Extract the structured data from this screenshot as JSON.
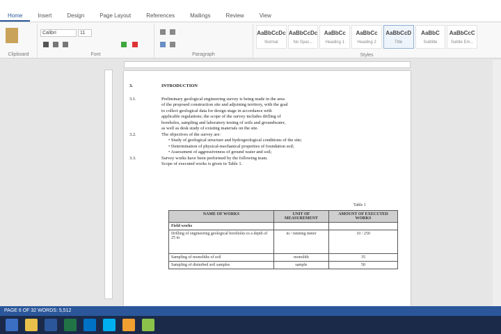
{
  "window": {
    "title": ""
  },
  "tabs": [
    {
      "label": "Home",
      "active": true
    },
    {
      "label": "Insert",
      "active": false
    },
    {
      "label": "Design",
      "active": false
    },
    {
      "label": "Page Layout",
      "active": false
    },
    {
      "label": "References",
      "active": false
    },
    {
      "label": "Mailings",
      "active": false
    },
    {
      "label": "Review",
      "active": false
    },
    {
      "label": "View",
      "active": false
    }
  ],
  "ribbon": {
    "font": "Calibri",
    "size": "11",
    "groups": [
      "Clipboard",
      "Font",
      "Paragraph",
      "Styles"
    ],
    "styles": [
      "AaBbCcDc",
      "AaBbCcDc",
      "AaBbCc",
      "AaBbCc",
      "AaBbCcD",
      "AaBbC",
      "AaBbCcC"
    ],
    "style_names": [
      "Normal",
      "No Spac...",
      "Heading 1",
      "Heading 2",
      "Title",
      "Subtitle",
      "Subtle Em..."
    ]
  },
  "document": {
    "sections": [
      {
        "num": "3.",
        "text": "INTRODUCTION"
      },
      {
        "num": "3.1.",
        "text": "Preliminary geological engineering survey is being made in the area"
      },
      {
        "num": "",
        "text": "of the proposed construction site and adjoining territory, with the goal"
      },
      {
        "num": "",
        "text": "to collect geological data for design stage in accordance with"
      },
      {
        "num": "",
        "text": "applicable regulations; the scope of the survey includes drilling of"
      },
      {
        "num": "",
        "text": "boreholes, sampling and laboratory testing of soils and groundwater,"
      },
      {
        "num": "",
        "text": "as well as desk study of existing materials on the site."
      },
      {
        "num": "3.2.",
        "text": "The objectives of the survey are:"
      },
      {
        "num": "",
        "text": "• Study of geological structure and hydrogeological conditions of the site;"
      },
      {
        "num": "",
        "text": "• Determination of physical-mechanical properties of foundation soil;"
      },
      {
        "num": "",
        "text": "• Assessment of aggressiveness of ground water and soil;"
      },
      {
        "num": "3.3.",
        "text": "Survey works have been performed by the following team."
      },
      {
        "num": "",
        "text": "Scope of executed works is given in Table 1."
      }
    ],
    "table_caption": "Table 1",
    "table_headers": [
      "NAME OF WORKS",
      "UNIT OF MEASUREMENT",
      "AMOUNT OF EXECUTED WORKS"
    ],
    "table_rows": [
      [
        "Field works",
        "",
        ""
      ],
      [
        "Drilling of engineering geological boreholes to a depth of 25 m",
        "m / running meter",
        "10 / 250"
      ],
      [
        "Sampling of monoliths of soil",
        "monolith",
        "35"
      ],
      [
        "Sampling of disturbed soil samples",
        "sample",
        "50"
      ]
    ]
  },
  "statusbar": {
    "text": "PAGE 6 OF 32   WORDS: 5,512"
  },
  "tray": {
    "time": "",
    "date": ""
  }
}
